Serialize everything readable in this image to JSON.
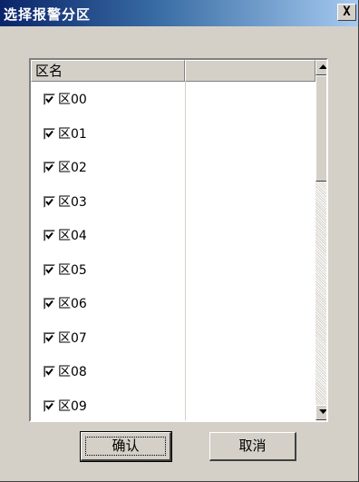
{
  "window": {
    "title": "选择报警分区",
    "close_glyph": "X"
  },
  "list": {
    "columns": [
      "区名",
      ""
    ],
    "rows": [
      {
        "label": "区00",
        "checked": true
      },
      {
        "label": "区01",
        "checked": true
      },
      {
        "label": "区02",
        "checked": true
      },
      {
        "label": "区03",
        "checked": true
      },
      {
        "label": "区04",
        "checked": true
      },
      {
        "label": "区05",
        "checked": true
      },
      {
        "label": "区06",
        "checked": true
      },
      {
        "label": "区07",
        "checked": true
      },
      {
        "label": "区08",
        "checked": true
      },
      {
        "label": "区09",
        "checked": true
      }
    ]
  },
  "buttons": {
    "ok": "确认",
    "cancel": "取消"
  },
  "colors": {
    "dialog_bg": "#d4d0c8",
    "title_start": "#0a246a",
    "title_end": "#a6caf0"
  }
}
